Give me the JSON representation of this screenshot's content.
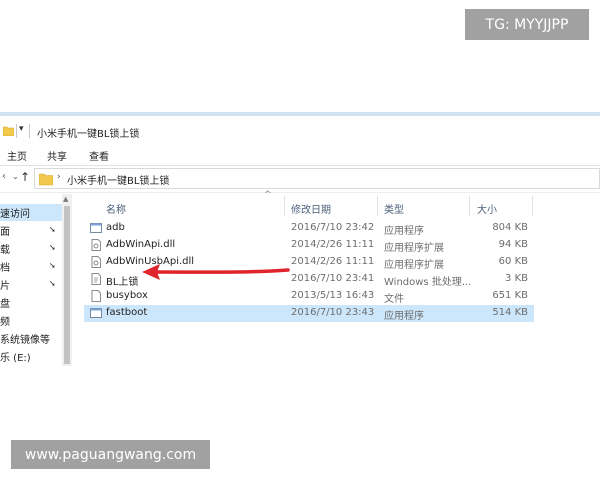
{
  "watermarks": {
    "top": "TG: MYYJJPP",
    "bottom": "www.paguangwang.com"
  },
  "window": {
    "title": "小米手机一键BL锁上锁",
    "quick_access_dropdown": "▾"
  },
  "ribbon": {
    "tabs": [
      "主页",
      "共享",
      "查看"
    ]
  },
  "address": {
    "path": "小米手机一键BL锁上锁",
    "nav_back": "‹",
    "nav_dropdown": "⌄",
    "nav_up": "↑",
    "chevron": "›"
  },
  "nav_pane": {
    "items": [
      {
        "label": "速访问",
        "pinned": false,
        "selected": true
      },
      {
        "label": "面",
        "pinned": true,
        "selected": false
      },
      {
        "label": "载",
        "pinned": true,
        "selected": false
      },
      {
        "label": "档",
        "pinned": true,
        "selected": false
      },
      {
        "label": "片",
        "pinned": true,
        "selected": false
      },
      {
        "label": "盘",
        "pinned": false,
        "selected": false
      },
      {
        "label": "频",
        "pinned": false,
        "selected": false
      },
      {
        "label": "系统镜像等",
        "pinned": false,
        "selected": false
      },
      {
        "label": "乐 (E:)",
        "pinned": false,
        "selected": false
      }
    ],
    "pin_glyph": "📌"
  },
  "columns": {
    "name": "名称",
    "date": "修改日期",
    "type": "类型",
    "size": "大小",
    "sort_glyph": "^"
  },
  "files": [
    {
      "name": "adb",
      "date": "2016/7/10 23:42",
      "type": "应用程序",
      "size": "804 KB",
      "icon": "exe-icon",
      "selected": false
    },
    {
      "name": "AdbWinApi.dll",
      "date": "2014/2/26 11:11",
      "type": "应用程序扩展",
      "size": "94 KB",
      "icon": "dll-icon",
      "selected": false
    },
    {
      "name": "AdbWinUsbApi.dll",
      "date": "2014/2/26 11:11",
      "type": "应用程序扩展",
      "size": "60 KB",
      "icon": "dll-icon",
      "selected": false
    },
    {
      "name": "BL上锁",
      "date": "2016/7/10 23:41",
      "type": "Windows 批处理...",
      "size": "3 KB",
      "icon": "bat-icon",
      "selected": false
    },
    {
      "name": "busybox",
      "date": "2013/5/13 16:43",
      "type": "文件",
      "size": "651 KB",
      "icon": "file-icon",
      "selected": false
    },
    {
      "name": "fastboot",
      "date": "2016/7/10 23:43",
      "type": "应用程序",
      "size": "514 KB",
      "icon": "exe-icon",
      "selected": true
    }
  ],
  "colors": {
    "selection": "#cce6fb",
    "arrow": "#e0242b",
    "watermark_bg": "#a1a1a1",
    "folder": "#f2c94c"
  }
}
